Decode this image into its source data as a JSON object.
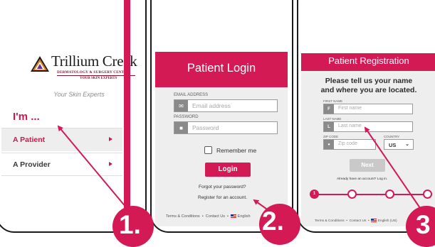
{
  "accent": "#d31a55",
  "phone1": {
    "logo_title": "Trillium Creek",
    "logo_sub": "DERMATOLOGY & SURGERY CENTER",
    "logo_sub2": "YOUR SKIN EXPERTS",
    "tagline": "Your Skin Experts",
    "heading": "I'm ...",
    "options": [
      {
        "label": "A Patient",
        "active": true
      },
      {
        "label": "A Provider",
        "active": false
      }
    ]
  },
  "phone2": {
    "title": "Patient Login",
    "email_label": "EMAIL ADDRESS",
    "email_placeholder": "Email address",
    "password_label": "PASSWORD",
    "password_placeholder": "Password",
    "remember": "Remember me",
    "login_button": "Login",
    "forgot": "Forgot your password?",
    "register": "Register for an account.",
    "footer_left": "Terms & Conditions",
    "footer_mid": "Contact Us",
    "footer_lang": "English"
  },
  "phone3": {
    "title": "Patient Registration",
    "heading_line1": "Please tell us your name",
    "heading_line2": "and where you are located.",
    "first_label": "FIRST NAME",
    "first_icon": "F",
    "first_placeholder": "First name",
    "last_label": "LAST NAME",
    "last_icon": "L",
    "last_placeholder": "Last name",
    "zip_label": "ZIP CODE",
    "zip_placeholder": "Zip code",
    "country_label": "COUNTRY",
    "country_value": "US",
    "next_button": "Next",
    "login_link": "Already have an account? Log in.",
    "step_active": "1",
    "footer_left": "Terms & Conditions",
    "footer_mid": "Contact Us",
    "footer_lang": "English (US)"
  },
  "badges": [
    "1.",
    "2.",
    "3"
  ]
}
